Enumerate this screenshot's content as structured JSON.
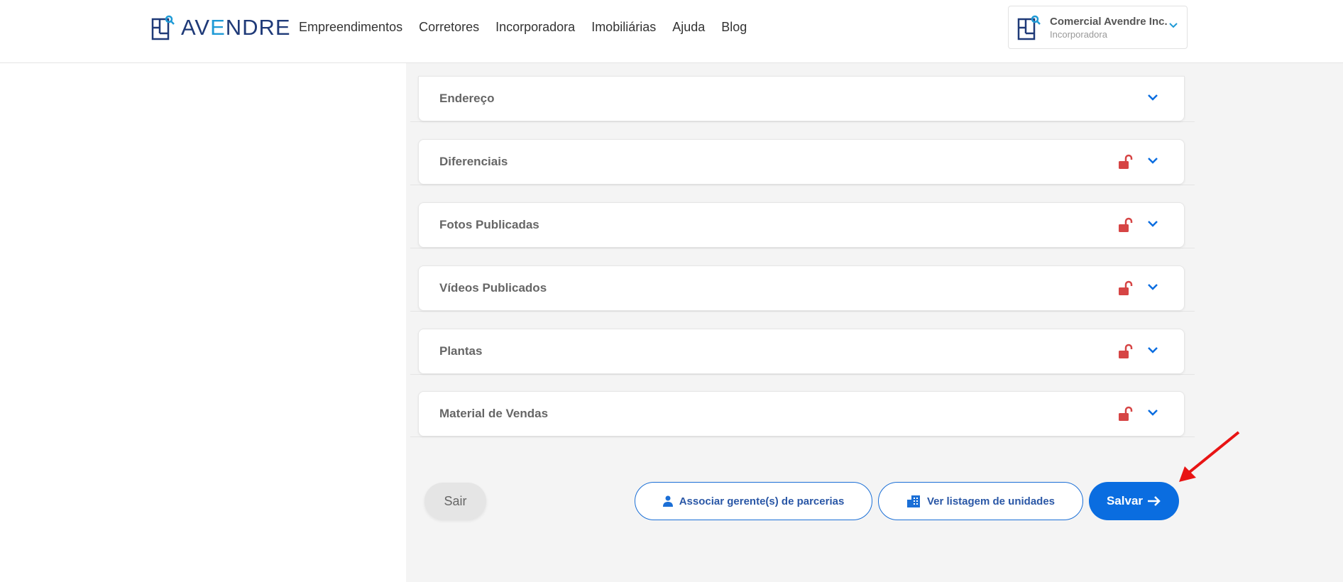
{
  "brand": {
    "logo_text_a": "AV",
    "logo_text_e": "E",
    "logo_text_b": "NDRE"
  },
  "nav": {
    "items": [
      "Empreendimentos",
      "Corretores",
      "Incorporadora",
      "Imobiliárias",
      "Ajuda",
      "Blog"
    ]
  },
  "account": {
    "name": "Comercial Avendre Inc.",
    "role": "Incorporadora"
  },
  "sections": [
    {
      "title": "Endereço",
      "locked_icon": false
    },
    {
      "title": "Diferenciais",
      "locked_icon": true
    },
    {
      "title": "Fotos Publicadas",
      "locked_icon": true
    },
    {
      "title": "Vídeos Publicados",
      "locked_icon": true
    },
    {
      "title": "Plantas",
      "locked_icon": true
    },
    {
      "title": "Material de Vendas",
      "locked_icon": true
    }
  ],
  "actions": {
    "exit_label": "Sair",
    "assoc_label": "Associar gerente(s) de parcerias",
    "listagem_label": "Ver listagem de unidades",
    "save_label": "Salvar"
  },
  "colors": {
    "accent": "#0a6de0",
    "lock": "#d64545",
    "brand_dark": "#1f3a78",
    "brand_light": "#1e9ad6"
  },
  "icons": {
    "lock": "unlocked-padlock-icon",
    "chevron": "chevron-down-icon",
    "person": "person-icon",
    "building": "building-icon",
    "arrow": "arrow-right-icon"
  }
}
